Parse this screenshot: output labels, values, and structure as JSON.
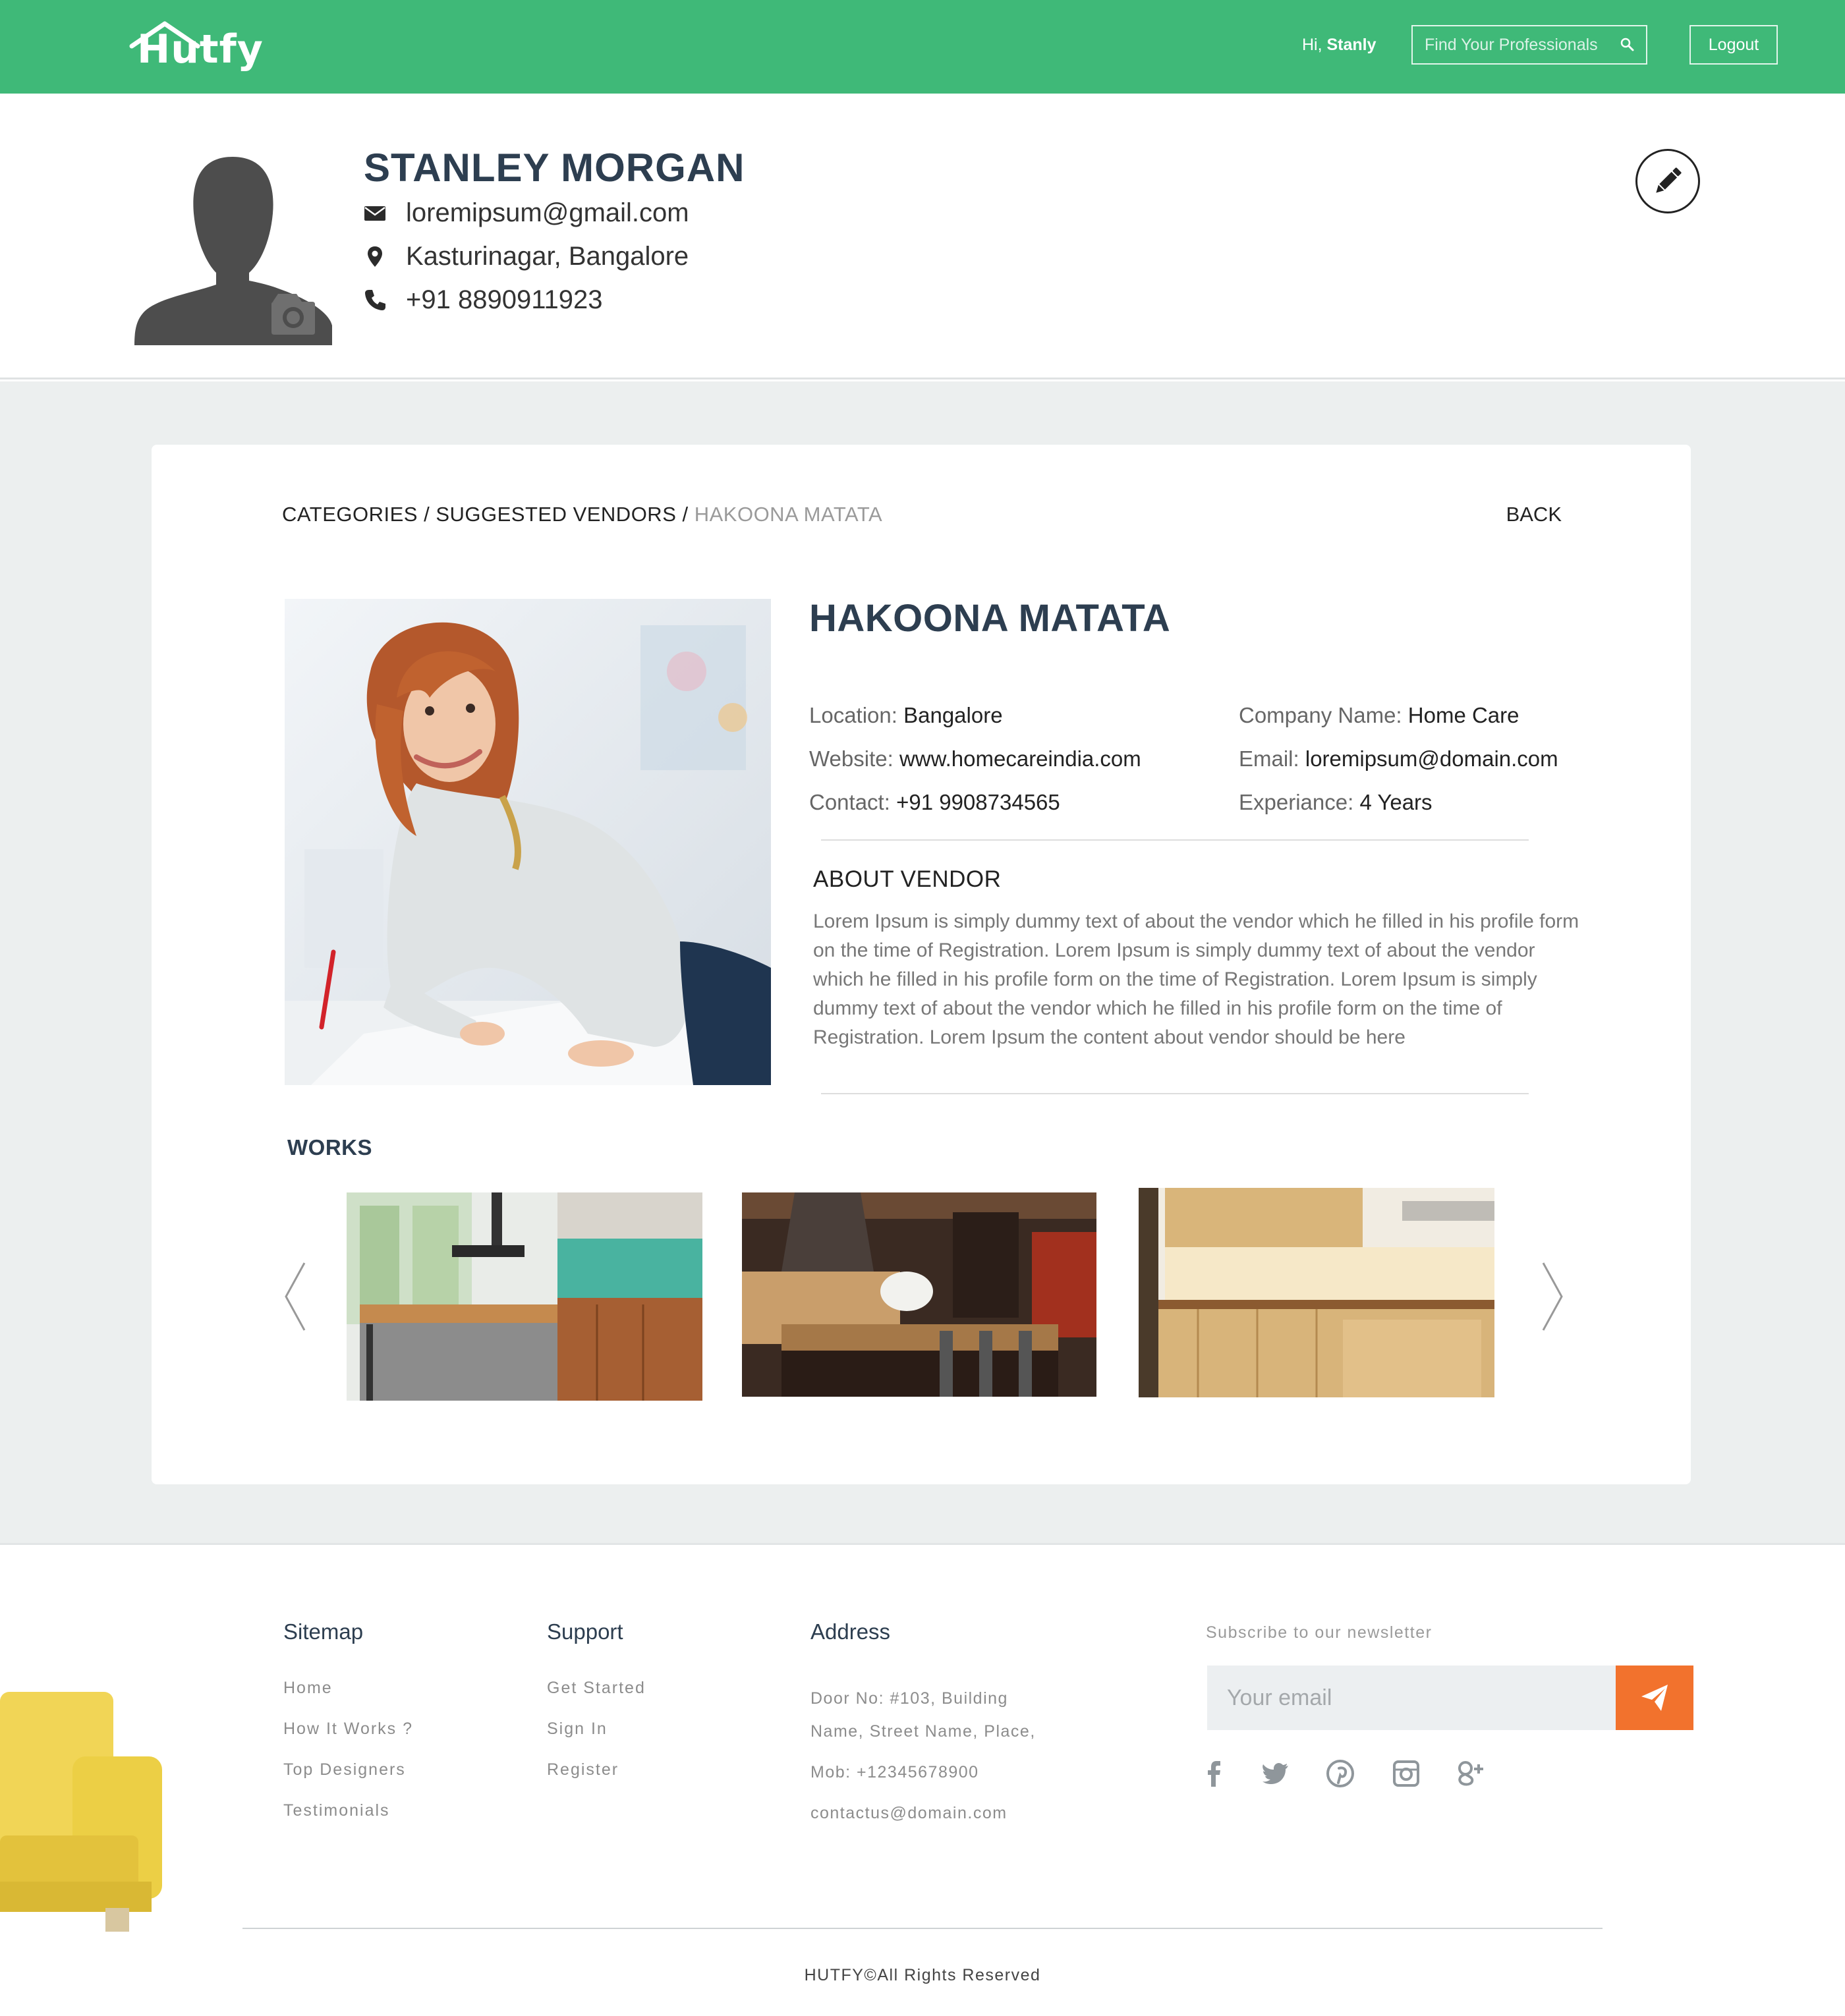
{
  "header": {
    "logo_text": "Hutfy",
    "greeting_prefix": "Hi, ",
    "greeting_user": "Stanly",
    "search_placeholder": "Find Your Professionals",
    "logout_label": "Logout",
    "brand_color": "#3fb978"
  },
  "profile": {
    "name": "STANLEY MORGAN",
    "email": "loremipsum@gmail.com",
    "location": "Kasturinagar, Bangalore",
    "phone": "+91 8890911923"
  },
  "breadcrumb": {
    "items": [
      "CATEGORIES",
      "SUGGESTED VENDORS"
    ],
    "separator": " / ",
    "current": "HAKOONA MATATA",
    "back_label": "BACK"
  },
  "vendor": {
    "name": "HAKOONA MATATA",
    "location_label": "Location:",
    "location": "Bangalore",
    "website_label": "Website:",
    "website": "www.homecareindia.com",
    "contact_label": "Contact:",
    "contact": "+91 9908734565",
    "company_label": "Company Name:",
    "company": "Home Care",
    "email_label": "Email:",
    "email": "loremipsum@domain.com",
    "experience_label": "Experiance:",
    "experience": "4 Years",
    "about_title": "ABOUT VENDOR",
    "about_text": "Lorem Ipsum is simply dummy text of about the vendor which he filled in his profile form on the time of Registration. Lorem Ipsum is simply dummy text of about the vendor which he filled in his profile form on the time of Registration. Lorem Ipsum is simply dummy text of about the vendor which he filled in his profile form on the time of Registration. Lorem Ipsum the content about vendor should be here"
  },
  "works": {
    "title": "WORKS",
    "items": [
      "kitchen-1",
      "kitchen-2",
      "kitchen-3"
    ]
  },
  "footer": {
    "sitemap_title": "Sitemap",
    "sitemap_links": [
      "Home",
      "How It Works ?",
      "Top Designers",
      "Testimonials"
    ],
    "support_title": "Support",
    "support_links": [
      "Get Started",
      "Sign In",
      "Register"
    ],
    "address_title": "Address",
    "address_lines": [
      "Door No: #103, Building",
      "Name, Street Name, Place,",
      "Mob: +12345678900",
      "contactus@domain.com"
    ],
    "newsletter_title": "Subscribe to our newsletter",
    "newsletter_placeholder": "Your email",
    "social": [
      "facebook-icon",
      "twitter-icon",
      "pinterest-icon",
      "instagram-icon",
      "google-plus-icon"
    ],
    "copyright": "HUTFY©All Rights Reserved",
    "accent_color": "#f2722d"
  }
}
